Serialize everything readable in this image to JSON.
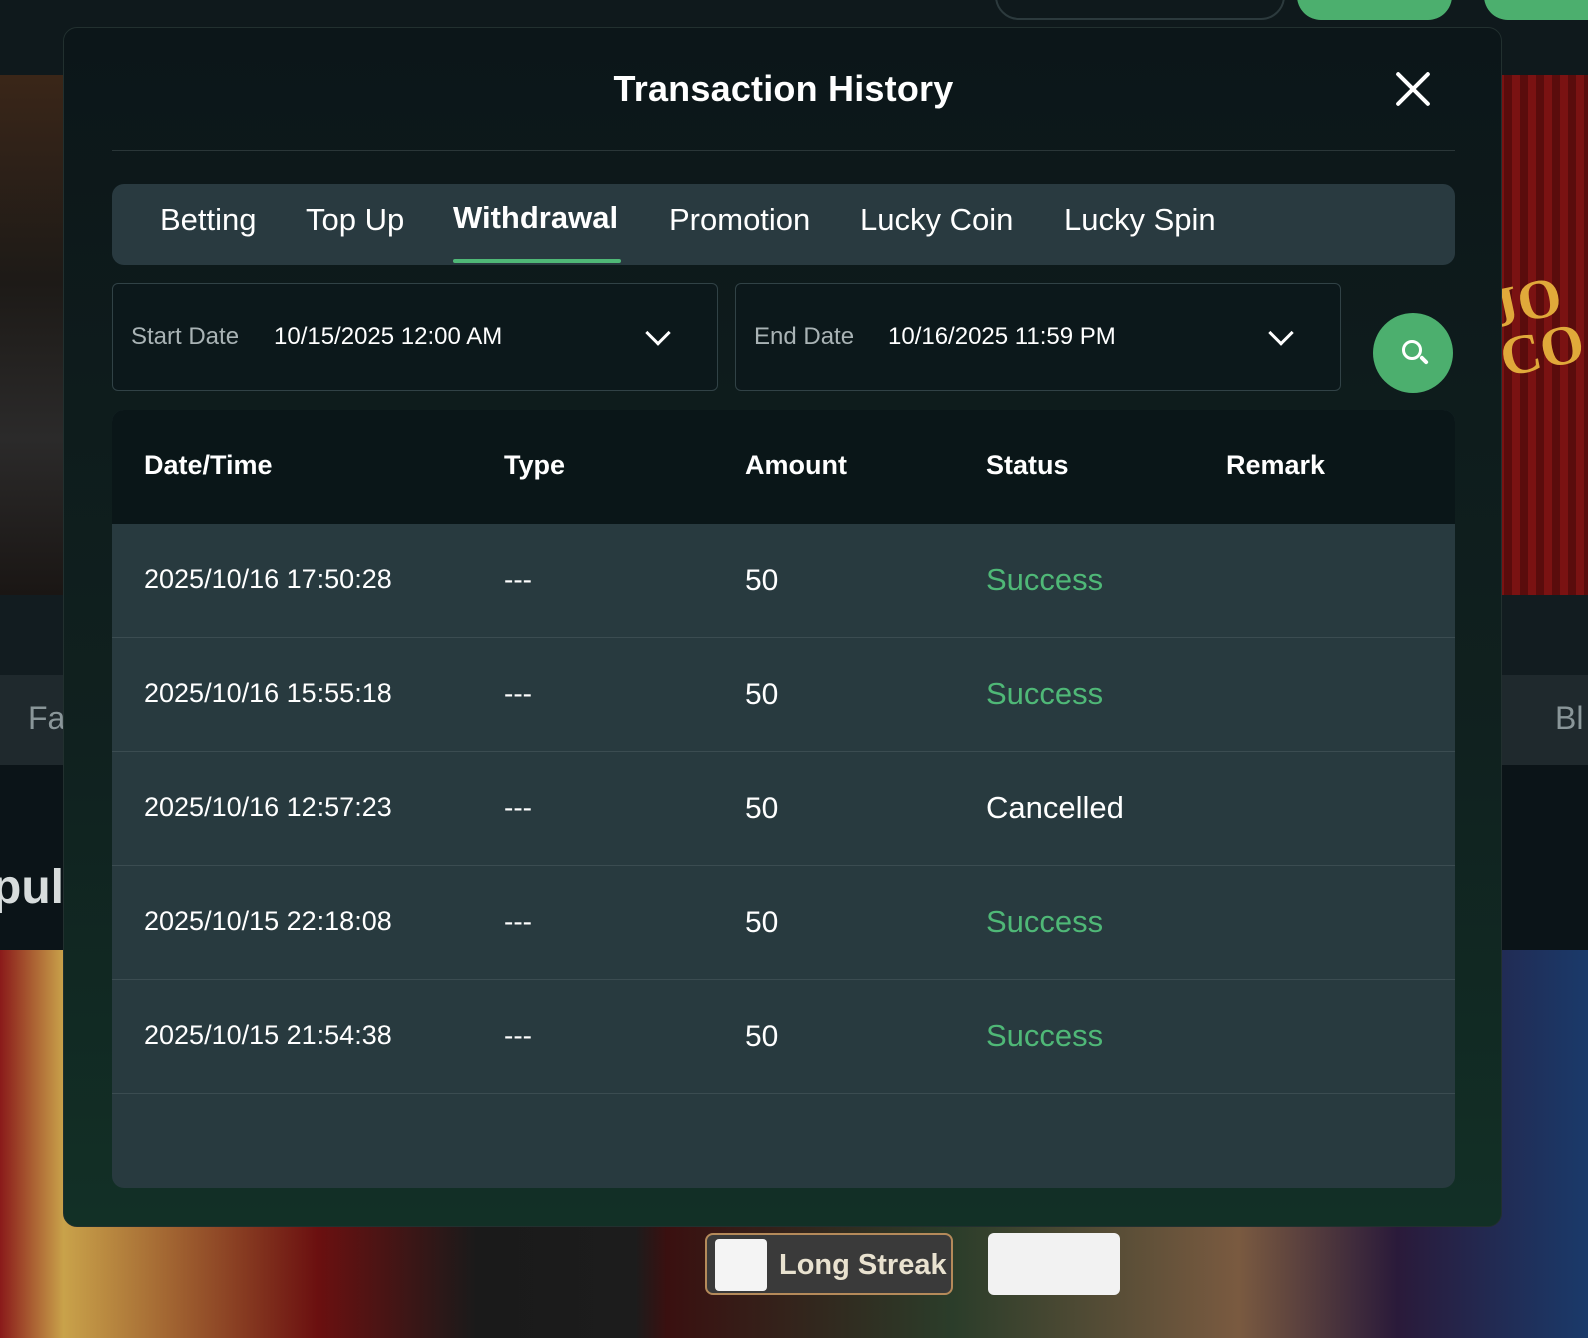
{
  "background": {
    "category_left": "Fa",
    "category_right": "Bl",
    "section_heading": "pula",
    "banner_text": "JO CO",
    "game_label": "Long Streak"
  },
  "modal": {
    "title": "Transaction History"
  },
  "tabs": [
    {
      "label": "Betting",
      "active": false
    },
    {
      "label": "Top Up",
      "active": false
    },
    {
      "label": "Withdrawal",
      "active": true
    },
    {
      "label": "Promotion",
      "active": false
    },
    {
      "label": "Lucky Coin",
      "active": false
    },
    {
      "label": "Lucky Spin",
      "active": false
    }
  ],
  "filters": {
    "start_label": "Start Date",
    "start_value": "10/15/2025 12:00 AM",
    "end_label": "End Date",
    "end_value": "10/16/2025 11:59 PM"
  },
  "table": {
    "columns": [
      "Date/Time",
      "Type",
      "Amount",
      "Status",
      "Remark"
    ],
    "rows": [
      {
        "datetime": "2025/10/16 17:50:28",
        "type": "---",
        "amount": "50",
        "status": "Success",
        "remark": ""
      },
      {
        "datetime": "2025/10/16 15:55:18",
        "type": "---",
        "amount": "50",
        "status": "Success",
        "remark": ""
      },
      {
        "datetime": "2025/10/16 12:57:23",
        "type": "---",
        "amount": "50",
        "status": "Cancelled",
        "remark": ""
      },
      {
        "datetime": "2025/10/15 22:18:08",
        "type": "---",
        "amount": "50",
        "status": "Success",
        "remark": ""
      },
      {
        "datetime": "2025/10/15 21:54:38",
        "type": "---",
        "amount": "50",
        "status": "Success",
        "remark": ""
      }
    ]
  },
  "colors": {
    "accent": "#4fb877",
    "success": "#4fb877",
    "cancelled": "#ffffff",
    "modal_bg": "#0c1619",
    "tab_bar_bg": "#293a40",
    "table_row_bg": "#283a3f"
  },
  "icons": {
    "close": "close-icon",
    "dropdown": "chevron-down-icon",
    "search": "search-icon"
  }
}
